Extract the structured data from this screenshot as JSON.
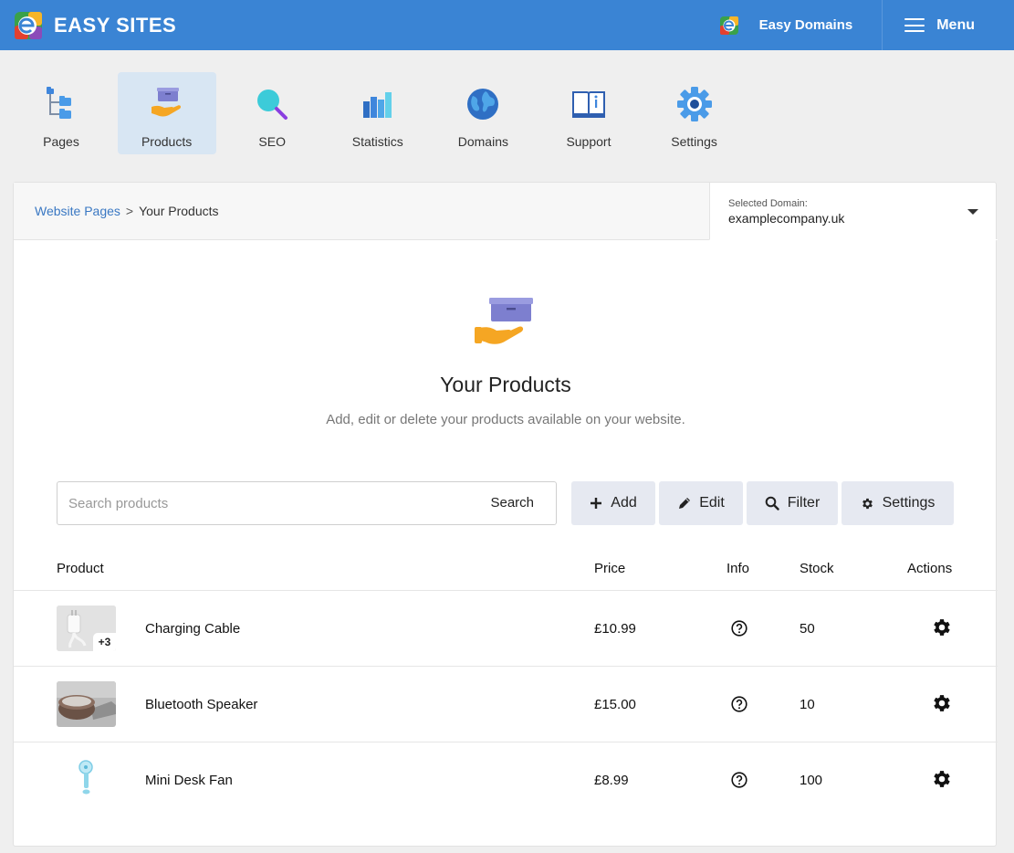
{
  "brand": {
    "name": "EASY SITES"
  },
  "header": {
    "domains_label": "Easy Domains",
    "menu_label": "Menu"
  },
  "nav": {
    "items": [
      {
        "label": "Pages"
      },
      {
        "label": "Products"
      },
      {
        "label": "SEO"
      },
      {
        "label": "Statistics"
      },
      {
        "label": "Domains"
      },
      {
        "label": "Support"
      },
      {
        "label": "Settings"
      }
    ]
  },
  "breadcrumb": {
    "parent": "Website Pages",
    "separator": ">",
    "current": "Your Products"
  },
  "domain_selector": {
    "caption": "Selected Domain:",
    "value": "examplecompany.uk"
  },
  "hero": {
    "title": "Your Products",
    "subtitle": "Add, edit or delete your products available on your website."
  },
  "search": {
    "placeholder": "Search products",
    "value": "",
    "button_label": "Search"
  },
  "toolbar": {
    "add_label": "Add",
    "edit_label": "Edit",
    "filter_label": "Filter",
    "settings_label": "Settings"
  },
  "table": {
    "headers": {
      "product": "Product",
      "price": "Price",
      "info": "Info",
      "stock": "Stock",
      "actions": "Actions"
    },
    "rows": [
      {
        "name": "Charging Cable",
        "price": "£10.99",
        "stock": "50",
        "extra_images": "+3"
      },
      {
        "name": "Bluetooth Speaker",
        "price": "£15.00",
        "stock": "10"
      },
      {
        "name": "Mini Desk Fan",
        "price": "£8.99",
        "stock": "100"
      }
    ]
  },
  "colors": {
    "topbar": "#3a84d4",
    "active_nav": "#d8e6f3",
    "link": "#3a78c3",
    "tool_button": "#e6e9f1"
  }
}
